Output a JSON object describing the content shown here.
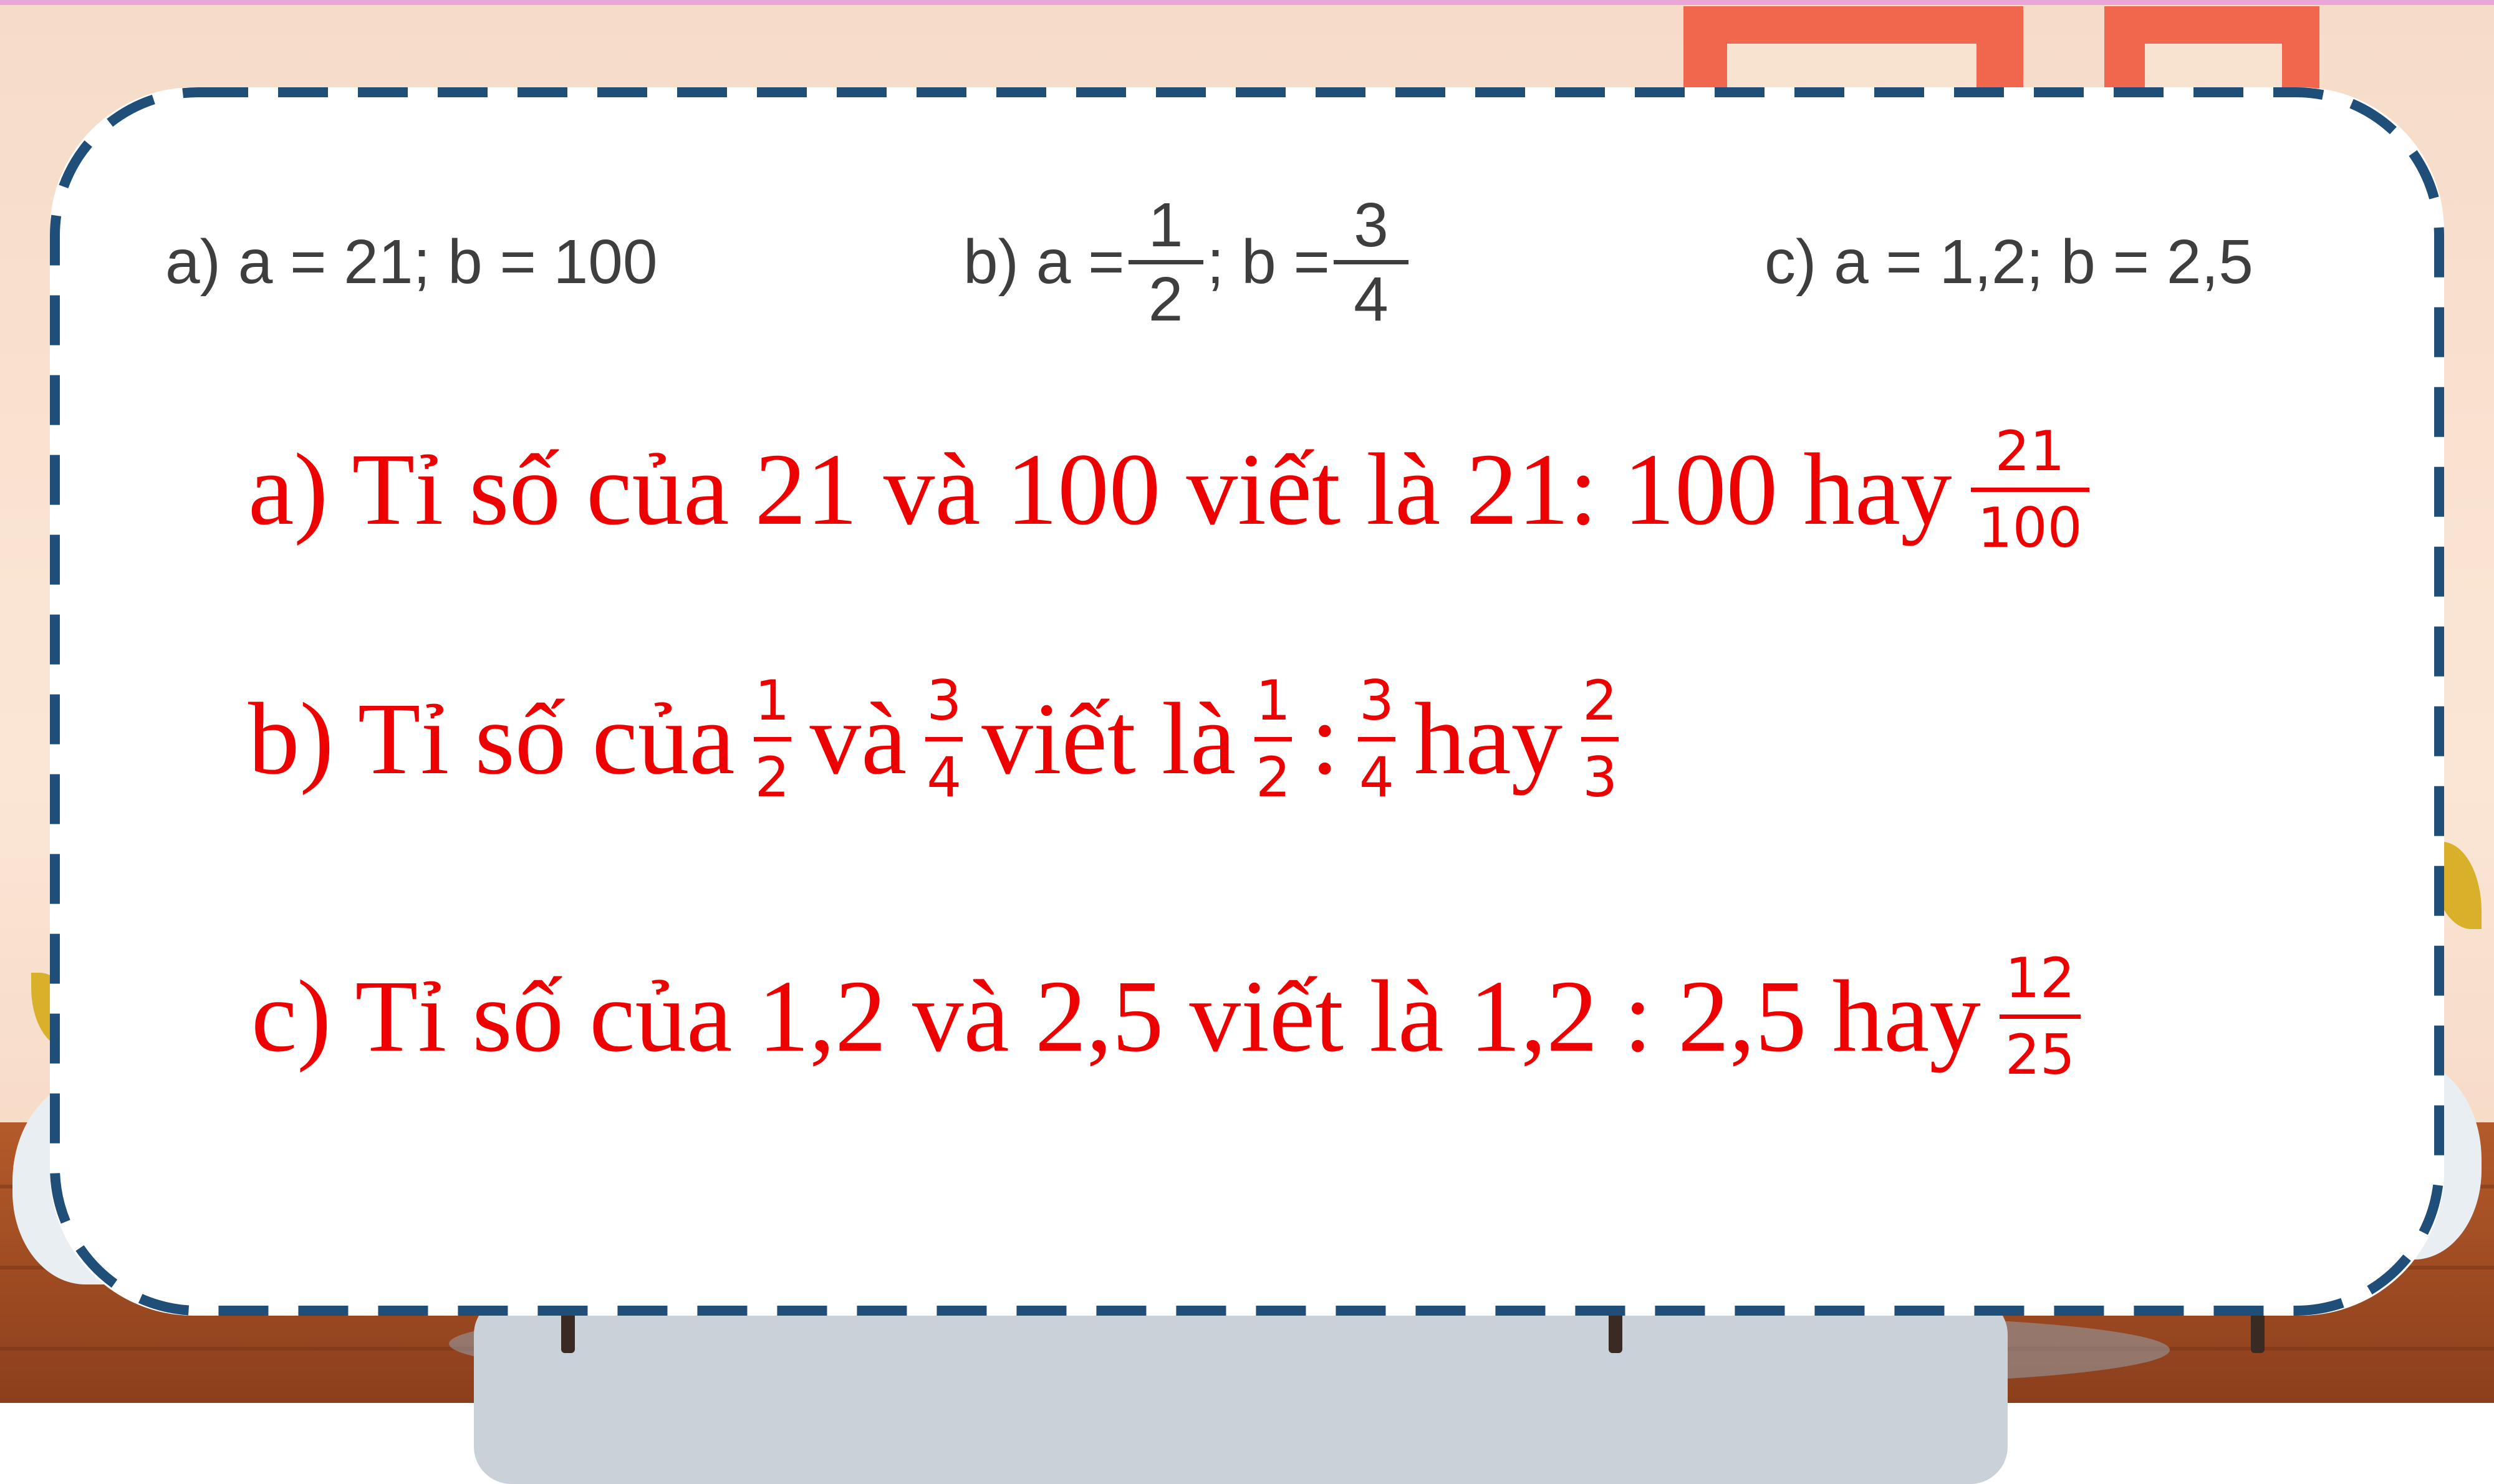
{
  "colors": {
    "answer_text": "#ee0000",
    "question_text": "#3e3e3e",
    "card_border": "#1f4e79",
    "card_fill": "#ffffff"
  },
  "question": {
    "a": {
      "prefix": "a) a = 21; b = 100"
    },
    "b": {
      "prefix": "b) a = ",
      "a_num": "1",
      "a_den": "2",
      "mid": "; b = ",
      "b_num": "3",
      "b_den": "4"
    },
    "c": {
      "prefix": "c) a = 1,2; b = 2,5"
    }
  },
  "answers": {
    "a": {
      "text": "a) Tỉ số của 21 và 100 viết là 21: 100 hay",
      "frac_num": "21",
      "frac_den": "100"
    },
    "b": {
      "lead": "b) Tỉ số của",
      "f1_num": "1",
      "f1_den": "2",
      "and": "và",
      "f2_num": "3",
      "f2_den": "4",
      "written": "viết là",
      "f3_num": "1",
      "f3_den": "2",
      "colon": ":",
      "f4_num": "3",
      "f4_den": "4",
      "hay": "hay",
      "f5_num": "2",
      "f5_den": "3"
    },
    "c": {
      "text": "c) Tỉ số của 1,2 và 2,5 viết là 1,2 : 2,5 hay",
      "frac_num": "12",
      "frac_den": "25"
    }
  }
}
